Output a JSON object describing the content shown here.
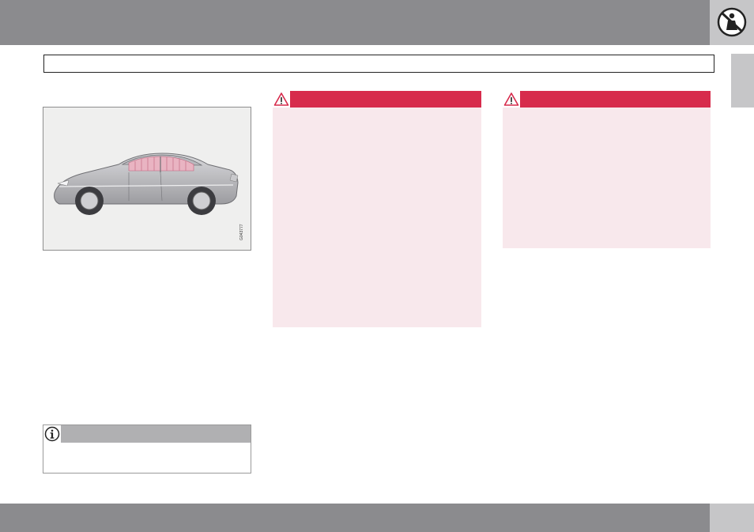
{
  "header": {
    "section_title": "",
    "corner_icon": "no-child-seat-icon"
  },
  "figure": {
    "image_code": "G043777",
    "image_subject": "car-side-curtain-airbag-illustration"
  },
  "warnings": [
    {
      "icon": "warning-triangle-icon",
      "title": "",
      "body": ""
    },
    {
      "icon": "warning-triangle-icon",
      "title": "",
      "body": ""
    }
  ],
  "note": {
    "icon": "info-icon",
    "title": "",
    "body": ""
  },
  "footer": {
    "page_number": ""
  },
  "colors": {
    "band_gray": "#8b8b8e",
    "corner_gray": "#c6c6c8",
    "warning_red": "#d72b4c",
    "warning_bg": "#f8e8ec",
    "note_gray": "#b0b0b2"
  }
}
